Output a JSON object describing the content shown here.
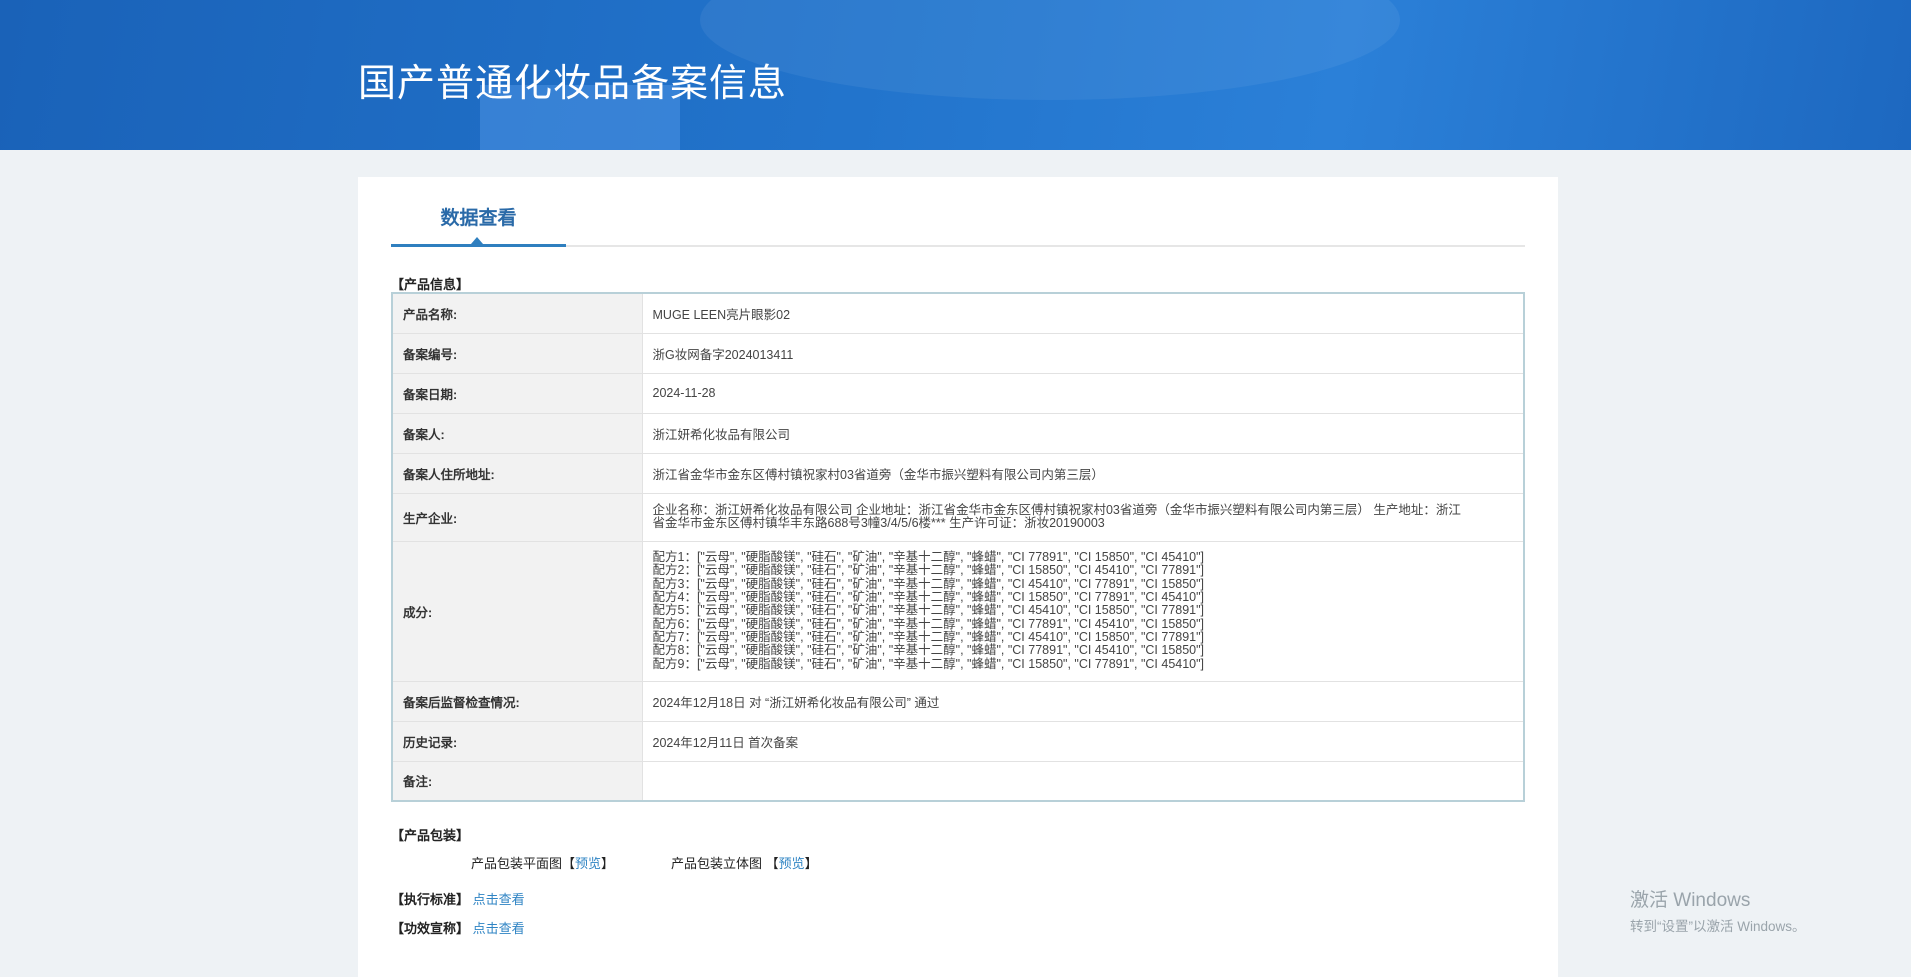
{
  "header": {
    "title": "国产普通化妆品备案信息"
  },
  "tab": {
    "label": "数据查看"
  },
  "product_info": {
    "section": "【产品信息】",
    "rows": [
      {
        "label": "产品名称:",
        "value": "MUGE LEEN亮片眼影02"
      },
      {
        "label": "备案编号:",
        "value": "浙G妆网备字2024013411"
      },
      {
        "label": "备案日期:",
        "value": "2024-11-28"
      },
      {
        "label": "备案人:",
        "value": "浙江妍希化妆品有限公司"
      },
      {
        "label": "备案人住所地址:",
        "value": "浙江省金华市金东区傅村镇祝家村03省道旁（金华市振兴塑料有限公司内第三层）"
      },
      {
        "label": "生产企业:",
        "value": "企业名称：浙江妍希化妆品有限公司 企业地址：浙江省金华市金东区傅村镇祝家村03省道旁（金华市振兴塑料有限公司内第三层） 生产地址：浙江省金华市金东区傅村镇华丰东路688号3幢3/4/5/6楼*** 生产许可证：浙妆20190003"
      },
      {
        "label": "成分:",
        "value": ""
      },
      {
        "label": "备案后监督检查情况:",
        "value": "2024年12月18日 对 “浙江妍希化妆品有限公司” 通过"
      },
      {
        "label": "历史记录:",
        "value": "2024年12月11日 首次备案"
      },
      {
        "label": "备注:",
        "value": ""
      }
    ],
    "ingredients": [
      "配方1：[\"云母\", \"硬脂酸镁\", \"硅石\", \"矿油\", \"辛基十二醇\", \"蜂蜡\", \"CI 77891\", \"CI 15850\", \"CI 45410\"]",
      "配方2：[\"云母\", \"硬脂酸镁\", \"硅石\", \"矿油\", \"辛基十二醇\", \"蜂蜡\", \"CI 15850\", \"CI 45410\", \"CI 77891\"]",
      "配方3：[\"云母\", \"硬脂酸镁\", \"硅石\", \"矿油\", \"辛基十二醇\", \"蜂蜡\", \"CI 45410\", \"CI 77891\", \"CI 15850\"]",
      "配方4：[\"云母\", \"硬脂酸镁\", \"硅石\", \"矿油\", \"辛基十二醇\", \"蜂蜡\", \"CI 15850\", \"CI 77891\", \"CI 45410\"]",
      "配方5：[\"云母\", \"硬脂酸镁\", \"硅石\", \"矿油\", \"辛基十二醇\", \"蜂蜡\", \"CI 45410\", \"CI 15850\", \"CI 77891\"]",
      "配方6：[\"云母\", \"硬脂酸镁\", \"硅石\", \"矿油\", \"辛基十二醇\", \"蜂蜡\", \"CI 77891\", \"CI 45410\", \"CI 15850\"]",
      "配方7：[\"云母\", \"硬脂酸镁\", \"硅石\", \"矿油\", \"辛基十二醇\", \"蜂蜡\", \"CI 45410\", \"CI 15850\", \"CI 77891\"]",
      "配方8：[\"云母\", \"硬脂酸镁\", \"硅石\", \"矿油\", \"辛基十二醇\", \"蜂蜡\", \"CI 77891\", \"CI 45410\", \"CI 15850\"]",
      "配方9：[\"云母\", \"硬脂酸镁\", \"硅石\", \"矿油\", \"辛基十二醇\", \"蜂蜡\", \"CI 15850\", \"CI 77891\", \"CI 45410\"]"
    ]
  },
  "packaging": {
    "section": "【产品包装】",
    "flat_label": "产品包装平面图",
    "solid_label": "产品包装立体图",
    "preview": "预览",
    "open": "【",
    "close": "】"
  },
  "standard": {
    "label": "【执行标准】",
    "link": "点击查看"
  },
  "claim": {
    "label": "【功效宣称】",
    "link": "点击查看"
  },
  "watermark": {
    "title": "激活 Windows",
    "sub": "转到“设置”以激活 Windows。"
  }
}
